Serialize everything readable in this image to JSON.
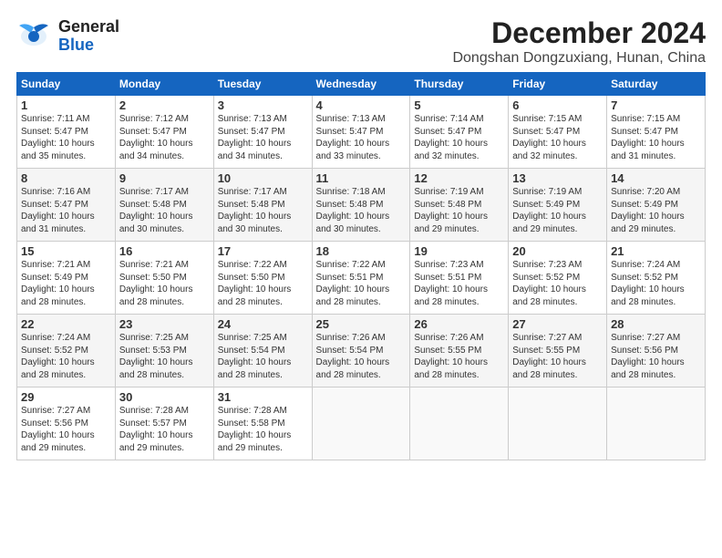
{
  "logo": {
    "line1": "General",
    "line2": "Blue"
  },
  "title": "December 2024",
  "subtitle": "Dongshan Dongzuxiang, Hunan, China",
  "weekdays": [
    "Sunday",
    "Monday",
    "Tuesday",
    "Wednesday",
    "Thursday",
    "Friday",
    "Saturday"
  ],
  "weeks": [
    [
      {
        "day": 1,
        "sunrise": "7:11 AM",
        "sunset": "5:47 PM",
        "daylight": "10 hours and 35 minutes."
      },
      {
        "day": 2,
        "sunrise": "7:12 AM",
        "sunset": "5:47 PM",
        "daylight": "10 hours and 34 minutes."
      },
      {
        "day": 3,
        "sunrise": "7:13 AM",
        "sunset": "5:47 PM",
        "daylight": "10 hours and 34 minutes."
      },
      {
        "day": 4,
        "sunrise": "7:13 AM",
        "sunset": "5:47 PM",
        "daylight": "10 hours and 33 minutes."
      },
      {
        "day": 5,
        "sunrise": "7:14 AM",
        "sunset": "5:47 PM",
        "daylight": "10 hours and 32 minutes."
      },
      {
        "day": 6,
        "sunrise": "7:15 AM",
        "sunset": "5:47 PM",
        "daylight": "10 hours and 32 minutes."
      },
      {
        "day": 7,
        "sunrise": "7:15 AM",
        "sunset": "5:47 PM",
        "daylight": "10 hours and 31 minutes."
      }
    ],
    [
      {
        "day": 8,
        "sunrise": "7:16 AM",
        "sunset": "5:47 PM",
        "daylight": "10 hours and 31 minutes."
      },
      {
        "day": 9,
        "sunrise": "7:17 AM",
        "sunset": "5:48 PM",
        "daylight": "10 hours and 30 minutes."
      },
      {
        "day": 10,
        "sunrise": "7:17 AM",
        "sunset": "5:48 PM",
        "daylight": "10 hours and 30 minutes."
      },
      {
        "day": 11,
        "sunrise": "7:18 AM",
        "sunset": "5:48 PM",
        "daylight": "10 hours and 30 minutes."
      },
      {
        "day": 12,
        "sunrise": "7:19 AM",
        "sunset": "5:48 PM",
        "daylight": "10 hours and 29 minutes."
      },
      {
        "day": 13,
        "sunrise": "7:19 AM",
        "sunset": "5:49 PM",
        "daylight": "10 hours and 29 minutes."
      },
      {
        "day": 14,
        "sunrise": "7:20 AM",
        "sunset": "5:49 PM",
        "daylight": "10 hours and 29 minutes."
      }
    ],
    [
      {
        "day": 15,
        "sunrise": "7:21 AM",
        "sunset": "5:49 PM",
        "daylight": "10 hours and 28 minutes."
      },
      {
        "day": 16,
        "sunrise": "7:21 AM",
        "sunset": "5:50 PM",
        "daylight": "10 hours and 28 minutes."
      },
      {
        "day": 17,
        "sunrise": "7:22 AM",
        "sunset": "5:50 PM",
        "daylight": "10 hours and 28 minutes."
      },
      {
        "day": 18,
        "sunrise": "7:22 AM",
        "sunset": "5:51 PM",
        "daylight": "10 hours and 28 minutes."
      },
      {
        "day": 19,
        "sunrise": "7:23 AM",
        "sunset": "5:51 PM",
        "daylight": "10 hours and 28 minutes."
      },
      {
        "day": 20,
        "sunrise": "7:23 AM",
        "sunset": "5:52 PM",
        "daylight": "10 hours and 28 minutes."
      },
      {
        "day": 21,
        "sunrise": "7:24 AM",
        "sunset": "5:52 PM",
        "daylight": "10 hours and 28 minutes."
      }
    ],
    [
      {
        "day": 22,
        "sunrise": "7:24 AM",
        "sunset": "5:52 PM",
        "daylight": "10 hours and 28 minutes."
      },
      {
        "day": 23,
        "sunrise": "7:25 AM",
        "sunset": "5:53 PM",
        "daylight": "10 hours and 28 minutes."
      },
      {
        "day": 24,
        "sunrise": "7:25 AM",
        "sunset": "5:54 PM",
        "daylight": "10 hours and 28 minutes."
      },
      {
        "day": 25,
        "sunrise": "7:26 AM",
        "sunset": "5:54 PM",
        "daylight": "10 hours and 28 minutes."
      },
      {
        "day": 26,
        "sunrise": "7:26 AM",
        "sunset": "5:55 PM",
        "daylight": "10 hours and 28 minutes."
      },
      {
        "day": 27,
        "sunrise": "7:27 AM",
        "sunset": "5:55 PM",
        "daylight": "10 hours and 28 minutes."
      },
      {
        "day": 28,
        "sunrise": "7:27 AM",
        "sunset": "5:56 PM",
        "daylight": "10 hours and 28 minutes."
      }
    ],
    [
      {
        "day": 29,
        "sunrise": "7:27 AM",
        "sunset": "5:56 PM",
        "daylight": "10 hours and 29 minutes."
      },
      {
        "day": 30,
        "sunrise": "7:28 AM",
        "sunset": "5:57 PM",
        "daylight": "10 hours and 29 minutes."
      },
      {
        "day": 31,
        "sunrise": "7:28 AM",
        "sunset": "5:58 PM",
        "daylight": "10 hours and 29 minutes."
      },
      null,
      null,
      null,
      null
    ]
  ]
}
